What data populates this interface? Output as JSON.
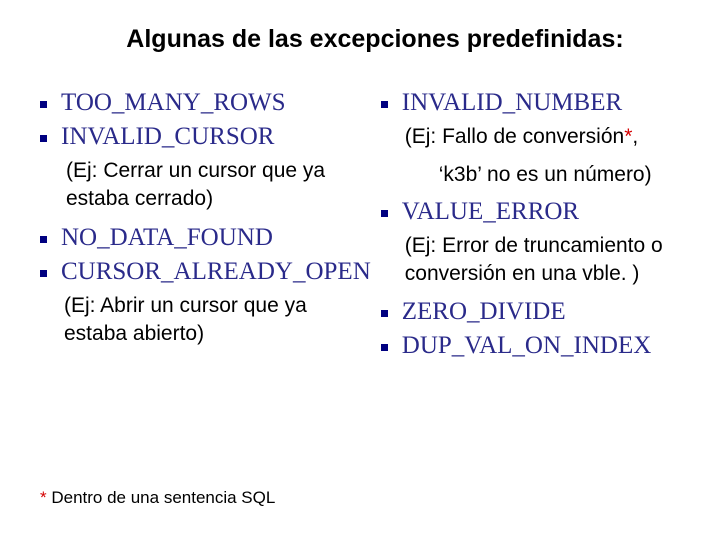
{
  "title": "Algunas de las excepciones predefinidas:",
  "left": {
    "i1": "TOO_MANY_ROWS",
    "i2": "INVALID_CURSOR",
    "i2ex": "(Ej: Cerrar un cursor que ya estaba cerrado)",
    "i3": "NO_DATA_FOUND",
    "i4": "CURSOR_ALREADY_OPEN",
    "i4ex": "(Ej: Abrir un cursor que ya estaba abierto)"
  },
  "right": {
    "i1": "INVALID_NUMBER",
    "i1ex_a": "(Ej: Fallo de conversión",
    "i1ex_star": "*",
    "i1ex_b": ",",
    "i1ex2": "‘k3b’ no es un número)",
    "i2": "VALUE_ERROR",
    "i2ex": "(Ej: Error de truncamiento o conversión en una vble. )",
    "i3": "ZERO_DIVIDE",
    "i4": "DUP_VAL_ON_INDEX"
  },
  "footnote_star": "*",
  "footnote": " Dentro de una sentencia SQL"
}
